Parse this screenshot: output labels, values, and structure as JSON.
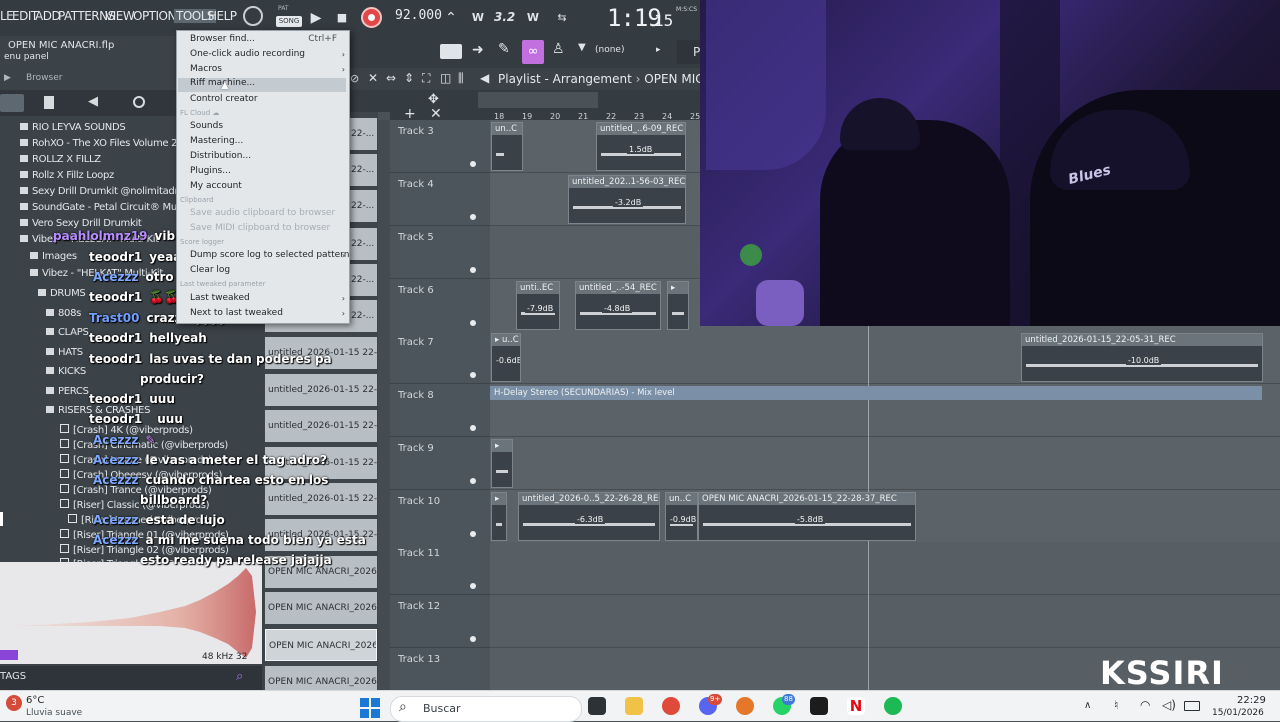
{
  "menubar": {
    "items": [
      "LE",
      "EDIT",
      "ADD",
      "PATTERNS",
      "VIEW",
      "OPTIONS",
      "TOOLS",
      "HELP"
    ],
    "pat_label": "PAT",
    "song_label": "SONG",
    "tempo": "92.000",
    "time": "1:19",
    "time_sub": "15",
    "time_unit": "M:S:CS",
    "tool_values": [
      "3.2"
    ]
  },
  "left_panel": {
    "file_title": "OPEN MIC ANACRI.flp",
    "menu_panel": "enu panel",
    "browser_label": "Browser",
    "tree": [
      {
        "label": "RIO LEYVA SOUNDS",
        "kind": "folder"
      },
      {
        "label": "RohXO - The XO Files Volume 2",
        "kind": "folder"
      },
      {
        "label": "ROLLZ X FILLZ",
        "kind": "folder"
      },
      {
        "label": "Rollz X Fillz Loopz",
        "kind": "folder"
      },
      {
        "label": "Sexy Drill Drumkit @nolimitadr0",
        "kind": "folder"
      },
      {
        "label": "SoundGate - Petal Circuit® Mult",
        "kind": "folder"
      },
      {
        "label": "Vero Sexy Drill Drumkit",
        "kind": "folder"
      },
      {
        "label": "Vibez - \"HELLCAT\" Multi-Kit",
        "kind": "folder"
      },
      {
        "label": "Images",
        "kind": "folder"
      },
      {
        "label": "Vibez - \"HELKAT\" Multi-Kit",
        "kind": "folder"
      },
      {
        "label": "DRUMS",
        "kind": "folder"
      },
      {
        "label": "808s",
        "kind": "folder"
      },
      {
        "label": "CLAPS",
        "kind": "folder"
      },
      {
        "label": "HATS",
        "kind": "folder"
      },
      {
        "label": "KICKS",
        "kind": "folder"
      },
      {
        "label": "PERCS",
        "kind": "folder"
      },
      {
        "label": "RISERS & CRASHES",
        "kind": "folder"
      },
      {
        "label": "[Crash] 4K (@viberprods)",
        "kind": "item"
      },
      {
        "label": "[Crash] Cinematic (@viberprods)",
        "kind": "item"
      },
      {
        "label": "[Crash] Insane (@viberprods)",
        "kind": "item"
      },
      {
        "label": "[Crash] Obeeesy (@viberprods)",
        "kind": "item"
      },
      {
        "label": "[Crash] Trance (@viberprods)",
        "kind": "item"
      },
      {
        "label": "[Riser] Classic (@viberprods)",
        "kind": "item"
      },
      {
        "label": "[Riser] Insane (@viberprods)",
        "kind": "item"
      },
      {
        "label": "[Riser] Triangle 01 (@viberprods)",
        "kind": "item"
      },
      {
        "label": "[Riser] Triangle 02 (@viberprods)",
        "kind": "item"
      },
      {
        "label": "[Riser] Triangle 03 (@viberprods)",
        "kind": "item"
      }
    ],
    "sample_rate": "48 kHz 32",
    "tags_label": "TAGS"
  },
  "chat": [
    {
      "user": "paahlolmnz19",
      "msg": "vibing",
      "user_color": "#b78cff"
    },
    {
      "user": "teoodr1",
      "msg": "yeaa",
      "user_color": "#ffffff"
    },
    {
      "user": "Acezzz",
      "msg": "otro open mic otro palo",
      "user_color": "#7fa8ff"
    },
    {
      "user": "teoodr1",
      "msg": "🍒🍒",
      "user_color": "#ffffff"
    },
    {
      "user": "Trast00",
      "msg": "crazzzzyyyy",
      "user_color": "#6fa0ff"
    },
    {
      "user": "teoodr1",
      "msg": "hellyeah",
      "user_color": "#ffffff"
    },
    {
      "user": "teoodr1",
      "msg": "las uvas te dan poderes pa",
      "user_color": "#ffffff"
    },
    {
      "user": "",
      "msg": "producir?",
      "user_color": "#ffffff"
    },
    {
      "user": "teoodr1",
      "msg": "uuu",
      "user_color": "#ffffff"
    },
    {
      "user": "teoodr1",
      "msg": "uuu",
      "user_color": "#ffffff"
    },
    {
      "user": "Acezzz",
      "msg": "",
      "user_color": "#7fa8ff"
    },
    {
      "user": "Acezzz",
      "msg": "le vas a meter el tag adro?",
      "user_color": "#7fa8ff"
    },
    {
      "user": "Acezzz",
      "msg": "cuando chartea esto en los",
      "user_color": "#7fa8ff"
    },
    {
      "user": "",
      "msg": "billboard?",
      "user_color": "#ffffff"
    },
    {
      "user": "Acezzz",
      "msg": "esta de lujo",
      "user_color": "#7fa8ff"
    },
    {
      "user": "Acezzz",
      "msg": "a mi me suena todo bien ya esta",
      "user_color": "#7fa8ff"
    },
    {
      "user": "",
      "msg": "esto ready pa release jajajja",
      "user_color": "#ffffff"
    }
  ],
  "dropdown": {
    "items": [
      {
        "label": "Browser find...",
        "shortcut": "Ctrl+F",
        "arrow": false,
        "disabled": false
      },
      {
        "label": "One-click audio recording",
        "shortcut": "",
        "arrow": true,
        "disabled": false
      },
      {
        "label": "Macros",
        "shortcut": "",
        "arrow": true,
        "disabled": false
      },
      {
        "label": "Riff machine...",
        "shortcut": "",
        "arrow": false,
        "disabled": false,
        "hover": true
      },
      {
        "label": "Control creator",
        "shortcut": "",
        "arrow": false,
        "disabled": false
      }
    ],
    "section_cloud": "FL Cloud",
    "cloud_items": [
      "Sounds",
      "Mastering...",
      "Distribution...",
      "Plugins...",
      "My account"
    ],
    "section_clipboard": "Clipboard",
    "clipboard_items": [
      "Save audio clipboard to browser",
      "Save MIDI clipboard to browser"
    ],
    "section_score": "Score logger",
    "score_items": [
      "Dump score log to selected pattern",
      "Clear log"
    ],
    "section_last": "Last tweaked parameter",
    "last_items": [
      "Last tweaked",
      "Next to last tweaked"
    ]
  },
  "playlist_toolbar": {
    "none_label": "(none)"
  },
  "playlist": {
    "title": "Playlist - Arrangement",
    "arrangement": "OPEN MIC ANA",
    "ruler": [
      "18",
      "19",
      "20",
      "21",
      "22",
      "23",
      "24",
      "25"
    ],
    "tracks": [
      {
        "name": "Track 3"
      },
      {
        "name": "Track 4"
      },
      {
        "name": "Track 5"
      },
      {
        "name": "Track 6"
      },
      {
        "name": "Track 7"
      },
      {
        "name": "Track 8"
      },
      {
        "name": "Track 9"
      },
      {
        "name": "Track 10"
      },
      {
        "name": "Track 11"
      },
      {
        "name": "Track 12"
      },
      {
        "name": "Track 13"
      }
    ],
    "clips": [
      {
        "track": 0,
        "label": "un..C",
        "db": ""
      },
      {
        "track": 0,
        "label": "untitled_..6-09_REC",
        "db": "1.5dB"
      },
      {
        "track": 1,
        "label": "untitled_202..1-56-03_REC",
        "db": "-3.2dB"
      },
      {
        "track": 3,
        "label": "unti..EC",
        "db": "-7.9dB"
      },
      {
        "track": 3,
        "label": "untitled_..-54_REC",
        "db": "-4.8dB"
      },
      {
        "track": 4,
        "label": "",
        "db": "-0.6dB"
      },
      {
        "track": 4,
        "label": "untitled_2026-01-15_22-05-31_REC",
        "db": "-10.0dB"
      },
      {
        "track": 7,
        "label": "untitled_2026-0..5_22-26-28_REC",
        "db": "-6.3dB"
      },
      {
        "track": 7,
        "label": "un..C",
        "db": "-0.9dB"
      },
      {
        "track": 7,
        "label": "OPEN MIC ANACRI_2026-01-15_22-28-37_REC",
        "db": "-5.8dB"
      }
    ],
    "automation": "H-Delay Stereo (SECUNDARIAS) - Mix level"
  },
  "rack": {
    "items": [
      "22-...",
      "22-...",
      "22-...",
      "22-...",
      "22-...",
      "22-...",
      "untitled_2026-01-15 22-...",
      "untitled_2026-01-15 22-...",
      "untitled_2026-01-15 22-...",
      "untitled_2026-01-15 22-...",
      "untitled_2026-01-15 22-...",
      "untitled_2026-01-15 22-...",
      "OPEN MIC ANACRI_2026-0...",
      "OPEN MIC ANACRI_2026-0...",
      "OPEN MIC ANACRI_2026-0...",
      "OPEN MIC ANACRI_2026-0..."
    ]
  },
  "watermark": "KSSIRI",
  "taskbar": {
    "weather_temp": "6°C",
    "weather_desc": "Lluvia suave",
    "weather_badge": "3",
    "search_placeholder": "Buscar",
    "time": "22:29",
    "date": "15/01/2026",
    "badges": {
      "discord": "9+",
      "whatsapp": "88"
    }
  }
}
